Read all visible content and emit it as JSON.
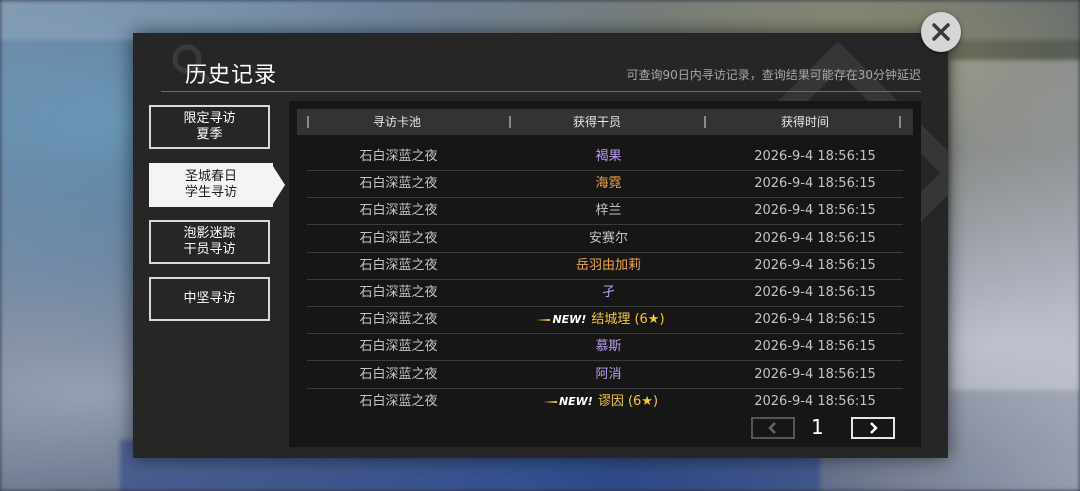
{
  "dialog": {
    "title": "历史记录",
    "subtitle": "可查询90日内寻访记录，查询结果可能存在30分钟延迟"
  },
  "sidebar": {
    "items": [
      {
        "line1": "限定寻访",
        "line2": "夏季",
        "active": false
      },
      {
        "line1": "圣城春日",
        "line2": "学生寻访",
        "active": true
      },
      {
        "line1": "泡影迷踪",
        "line2": "干员寻访",
        "active": false
      },
      {
        "line1": "中坚寻访",
        "line2": "",
        "active": false
      }
    ]
  },
  "table": {
    "headers": [
      "寻访卡池",
      "获得干员",
      "获得时间"
    ],
    "rows": [
      {
        "pool": "石白深蓝之夜",
        "operator": "褐果",
        "rarity": "purple",
        "new": "",
        "time": "2026-9-4 18:56:15"
      },
      {
        "pool": "石白深蓝之夜",
        "operator": "海霓",
        "rarity": "orange",
        "new": "",
        "time": "2026-9-4 18:56:15"
      },
      {
        "pool": "石白深蓝之夜",
        "operator": "梓兰",
        "rarity": "gray",
        "new": "",
        "time": "2026-9-4 18:56:15"
      },
      {
        "pool": "石白深蓝之夜",
        "operator": "安赛尔",
        "rarity": "gray",
        "new": "",
        "time": "2026-9-4 18:56:15"
      },
      {
        "pool": "石白深蓝之夜",
        "operator": "岳羽由加莉",
        "rarity": "orange",
        "new": "",
        "time": "2026-9-4 18:56:15"
      },
      {
        "pool": "石白深蓝之夜",
        "operator": "孑",
        "rarity": "purple",
        "new": "",
        "time": "2026-9-4 18:56:15"
      },
      {
        "pool": "石白深蓝之夜",
        "operator": "结城理 (6★)",
        "rarity": "gold",
        "new": "NEW!",
        "time": "2026-9-4 18:56:15"
      },
      {
        "pool": "石白深蓝之夜",
        "operator": "慕斯",
        "rarity": "purple",
        "new": "",
        "time": "2026-9-4 18:56:15"
      },
      {
        "pool": "石白深蓝之夜",
        "operator": "阿消",
        "rarity": "purple",
        "new": "",
        "time": "2026-9-4 18:56:15"
      },
      {
        "pool": "石白深蓝之夜",
        "operator": "谬因 (6★)",
        "rarity": "gold",
        "new": "NEW!",
        "time": "2026-9-4 18:56:15"
      }
    ]
  },
  "pager": {
    "page": "1",
    "prev_icon": "chevron-left-icon",
    "next_icon": "chevron-right-icon"
  },
  "close_icon": "close-icon",
  "colors": {
    "purple": "#b89cf0",
    "orange": "#f0a64a",
    "gold": "#f5c83a",
    "panel_bg": "#262626",
    "table_bg": "#161616"
  }
}
